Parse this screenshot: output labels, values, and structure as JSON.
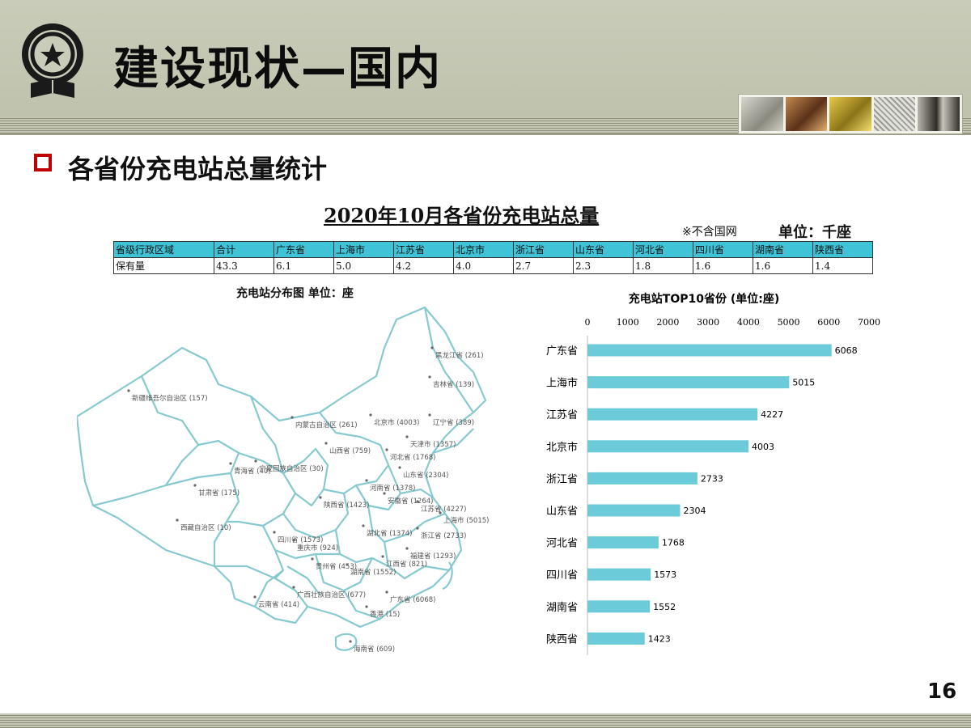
{
  "header": {
    "title": "建设现状—国内"
  },
  "section": {
    "heading": "各省份充电站总量统计"
  },
  "table": {
    "title": "2020年10月各省份充电站总量",
    "note": "※不含国网",
    "unit": "单位：千座",
    "columns": [
      "省级行政区域",
      "合计",
      "广东省",
      "上海市",
      "江苏省",
      "北京市",
      "浙江省",
      "山东省",
      "河北省",
      "四川省",
      "湖南省",
      "陕西省"
    ],
    "row": [
      "保有量",
      "43.3",
      "6.1",
      "5.0",
      "4.2",
      "4.0",
      "2.7",
      "2.3",
      "1.8",
      "1.6",
      "1.6",
      "1.4"
    ]
  },
  "map": {
    "title": "充电站分布图  单位：座",
    "labels": [
      "黑龙江省 (261)",
      "吉林省 (139)",
      "辽宁省 (389)",
      "北京市 (4003)",
      "天津市 (1357)",
      "河北省 (1768)",
      "山东省 (2304)",
      "内蒙古自治区 (261)",
      "新疆维吾尔自治区 (157)",
      "山西省 (759)",
      "宁夏回族自治区 (30)",
      "青海省 (40)",
      "甘肃省 (175)",
      "陕西省 (1423)",
      "河南省 (1378)",
      "安徽省 (1264)",
      "江苏省 (4227)",
      "上海市 (5015)",
      "浙江省 (2733)",
      "湖北省 (1374)",
      "西藏自治区 (10)",
      "四川省 (1573)",
      "重庆市 (924)",
      "福建省 (1293)",
      "江西省 (821)",
      "贵州省 (453)",
      "湖南省 (1552)",
      "广西壮族自治区 (677)",
      "广东省 (6068)",
      "云南省 (414)",
      "香港 (15)",
      "海南省 (609)"
    ]
  },
  "chart_data": {
    "type": "bar",
    "orientation": "horizontal",
    "title": "充电站TOP10省份 (单位:座)",
    "categories": [
      "广东省",
      "上海市",
      "江苏省",
      "北京市",
      "浙江省",
      "山东省",
      "河北省",
      "四川省",
      "湖南省",
      "陕西省"
    ],
    "values": [
      6068,
      5015,
      4227,
      4003,
      2733,
      2304,
      1768,
      1573,
      1552,
      1423
    ],
    "xlim": [
      0,
      7000
    ],
    "ticks": [
      0,
      1000,
      2000,
      3000,
      4000,
      5000,
      6000,
      7000
    ],
    "bar_color": "#6ccbd8",
    "grid": false,
    "legend": "none"
  },
  "footer": {
    "page_number": "16"
  }
}
